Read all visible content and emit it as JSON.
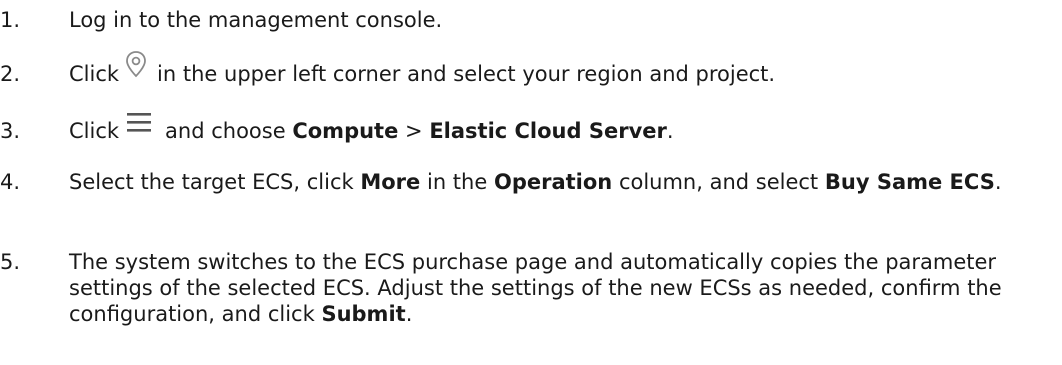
{
  "steps": [
    {
      "number": "1.",
      "text": "Log in to the management console."
    },
    {
      "number": "2.",
      "before": "Click",
      "icon": "location-pin-icon",
      "after": "in the upper left corner and select your region and project."
    },
    {
      "number": "3.",
      "before": "Click",
      "icon": "hamburger-menu-icon",
      "mid": "and choose",
      "bold1": "Compute",
      "sep": ">",
      "bold2": "Elastic Cloud Server",
      "end": "."
    },
    {
      "number": "4.",
      "t1": "Select the target ECS, click",
      "b1": "More",
      "t2": "in the",
      "b2": "Operation",
      "t3": "column, and select",
      "b3": "Buy Same ECS",
      "end": "."
    },
    {
      "number": "5.",
      "text": "The system switches to the ECS purchase page and automatically copies the parameter settings of the selected ECS. Adjust the settings of the new ECSs as needed, confirm the configuration, and click",
      "b1": "Submit",
      "end": "."
    }
  ],
  "colors": {
    "text": "#1a1a1a",
    "icon": "#8a8a8a"
  }
}
